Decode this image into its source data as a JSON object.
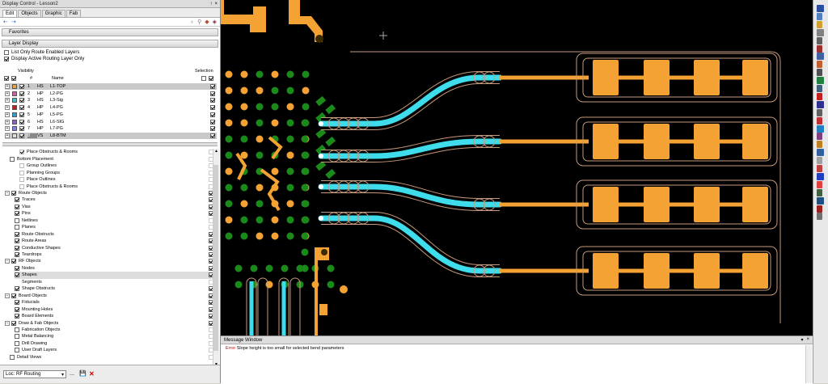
{
  "panel": {
    "title": "Display Control - Lesson2",
    "pin": "↑",
    "close": "×",
    "tabs": [
      "Edit",
      "Objects",
      "Graphic",
      "Fab"
    ],
    "favorites": "Favorites",
    "layer_display": "Layer Display",
    "options": [
      {
        "label": "List Only Route Enabled Layers",
        "checked": false
      },
      {
        "label": "Display Active Routing Layer Only",
        "checked": true
      }
    ],
    "visibility_label": "Visibility",
    "selection_label": "Selection",
    "col_num": "#",
    "col_name": "Name"
  },
  "layers": [
    {
      "num": "1",
      "type": "HS",
      "name": "L1-TOP",
      "color": "#e8a040",
      "selected": true
    },
    {
      "num": "2",
      "type": "HP",
      "name": "L2-PG",
      "color": "#d060a0",
      "selected": false
    },
    {
      "num": "3",
      "type": "HS",
      "name": "L3-Sig",
      "color": "#40c0c0",
      "selected": false
    },
    {
      "num": "4",
      "type": "HP",
      "name": "L4-PG",
      "color": "#c02020",
      "selected": false
    },
    {
      "num": "5",
      "type": "HP",
      "name": "L5-PG",
      "color": "#30a0d0",
      "selected": false
    },
    {
      "num": "6",
      "type": "HS",
      "name": "L6-SIG",
      "color": "#9060c0",
      "selected": false
    },
    {
      "num": "7",
      "type": "HP",
      "name": "L7-PG",
      "color": "#8080e0",
      "selected": false
    },
    {
      "num": "8",
      "type": "VS",
      "name": "L8-BTM",
      "color": "#e0e0e0",
      "selected": true
    }
  ],
  "tree": [
    {
      "label": "Place Obstructs & Rooms",
      "indent": 3,
      "checked": true,
      "group": false,
      "grey": true
    },
    {
      "label": "Bottom Placement",
      "indent": 1,
      "checked": false,
      "group": false,
      "grey": false
    },
    {
      "label": "Group Outlines",
      "indent": 3,
      "checked": false,
      "group": false,
      "grey": true
    },
    {
      "label": "Planning Groups",
      "indent": 3,
      "checked": false,
      "group": false,
      "grey": true
    },
    {
      "label": "Place Outlines",
      "indent": 3,
      "checked": false,
      "group": false,
      "grey": true
    },
    {
      "label": "Place Obstructs & Rooms",
      "indent": 3,
      "checked": false,
      "group": false,
      "grey": true
    },
    {
      "label": "Route Objects",
      "indent": 0,
      "checked": true,
      "group": true,
      "grey": false
    },
    {
      "label": "Traces",
      "indent": 2,
      "checked": true,
      "group": false,
      "grey": false
    },
    {
      "label": "Vias",
      "indent": 2,
      "checked": true,
      "group": false,
      "grey": false
    },
    {
      "label": "Pins",
      "indent": 2,
      "checked": true,
      "group": false,
      "grey": false
    },
    {
      "label": "Netlines",
      "indent": 2,
      "checked": false,
      "group": false,
      "grey": false
    },
    {
      "label": "Planes",
      "indent": 2,
      "checked": false,
      "group": false,
      "grey": false
    },
    {
      "label": "Route Obstructs",
      "indent": 2,
      "checked": true,
      "group": false,
      "grey": false
    },
    {
      "label": "Route Areas",
      "indent": 2,
      "checked": true,
      "group": false,
      "grey": false
    },
    {
      "label": "Conductive Shapes",
      "indent": 2,
      "checked": true,
      "group": false,
      "grey": false
    },
    {
      "label": "Teardrops",
      "indent": 2,
      "checked": true,
      "group": false,
      "grey": false
    },
    {
      "label": "RF Objects",
      "indent": 0,
      "checked": true,
      "group": true,
      "grey": false
    },
    {
      "label": "Nodes",
      "indent": 2,
      "checked": true,
      "group": false,
      "grey": false
    },
    {
      "label": "Shapes",
      "indent": 2,
      "checked": true,
      "group": false,
      "grey": false,
      "hl": true
    },
    {
      "label": "Segments",
      "indent": 2,
      "checked": false,
      "group": false,
      "grey": false,
      "nochk": true
    },
    {
      "label": "Shape Obstructs",
      "indent": 2,
      "checked": true,
      "group": false,
      "grey": false
    },
    {
      "label": "Board Objects",
      "indent": 0,
      "checked": true,
      "group": true,
      "grey": false
    },
    {
      "label": "Fiducials",
      "indent": 2,
      "checked": true,
      "group": false,
      "grey": false
    },
    {
      "label": "Mounting Holes",
      "indent": 2,
      "checked": true,
      "group": false,
      "grey": false
    },
    {
      "label": "Board Elements",
      "indent": 2,
      "checked": true,
      "group": false,
      "grey": false
    },
    {
      "label": "Draw & Fab Objects",
      "indent": 0,
      "checked": true,
      "group": true,
      "grey": false
    },
    {
      "label": "Fabrication Objects",
      "indent": 2,
      "checked": false,
      "group": false,
      "grey": false
    },
    {
      "label": "Metal Balancing",
      "indent": 2,
      "checked": false,
      "group": false,
      "grey": false
    },
    {
      "label": "Drill Drawing",
      "indent": 2,
      "checked": false,
      "group": false,
      "grey": false
    },
    {
      "label": "User Draft Layers",
      "indent": 2,
      "checked": false,
      "group": false,
      "grey": false
    },
    {
      "label": "Detail Views",
      "indent": 1,
      "checked": false,
      "group": false,
      "grey": false
    }
  ],
  "bottom": {
    "scheme": "Loc: RF Routing",
    "dots": "...",
    "save": "💾",
    "delete": "✕"
  },
  "message": {
    "title": "Message Window",
    "level": "Error",
    "text": "Slope height is too small for selected bend parameters"
  },
  "colors": {
    "pad": "#f4a233",
    "trace_cyan": "#3fdcec",
    "via_green": "#1a8a1a",
    "outline": "#c69a7c",
    "background": "#000000"
  }
}
